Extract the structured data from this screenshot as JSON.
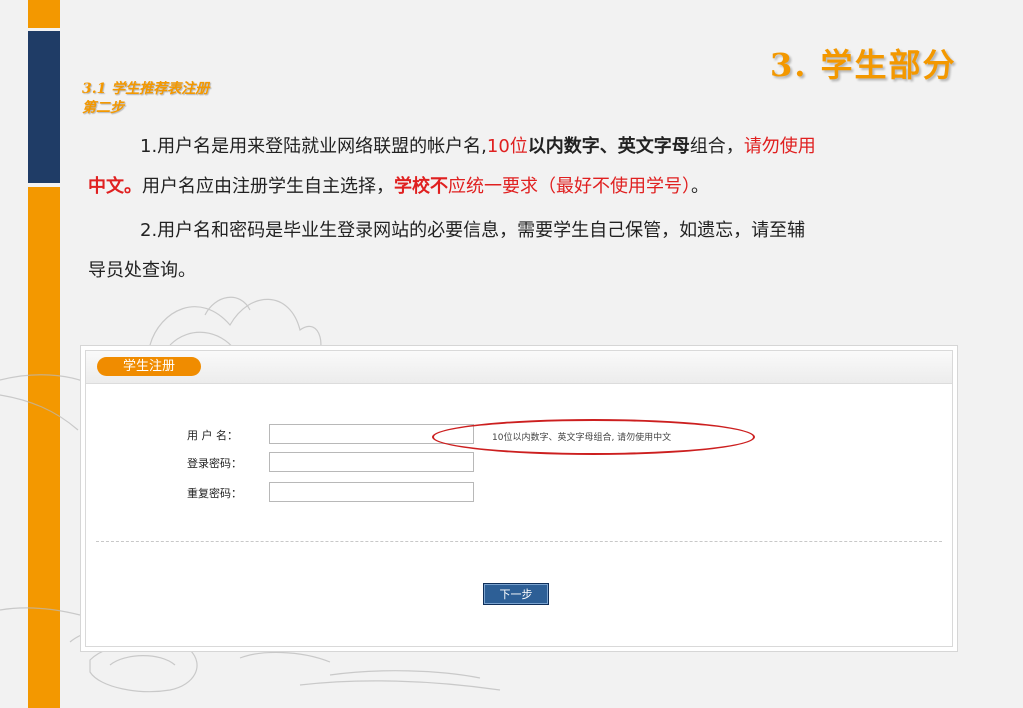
{
  "slide": {
    "title": "3. 学生部分",
    "section_line1": "3.1 学生推荐表注册",
    "section_line2": "第二步"
  },
  "paragraphs": {
    "p1": {
      "a": "1.用户名是用来登陆就业网络联盟的帐户名,",
      "b": "10位",
      "c": "以内数字、英文字母",
      "d": "组合，",
      "e": "请勿使用",
      "f": "中文。",
      "g": "用户名应由注册学生自主选择，",
      "h": "学校不",
      "i": "应统一要求（最好不使用学号）",
      "j": "。"
    },
    "p2": {
      "a": "2.用户名和密码是毕业生登录网站的必要信息，需要学生自己保管，如遗忘，请至辅",
      "b": "导员处查询。"
    }
  },
  "form": {
    "tab_label": "学生注册",
    "username_label": "用 户 名：",
    "login_password_label": "登录密码：",
    "repeat_password_label": "重复密码：",
    "username_value": "",
    "login_password_value": "",
    "repeat_password_value": "",
    "username_hint": "10位以内数字、英文字母组合, 请勿使用中文",
    "next_button": "下一步"
  },
  "colors": {
    "accent_orange": "#f39800",
    "navy": "#1f3c66",
    "highlight_red": "#e02020",
    "button_blue": "#2d5f96"
  }
}
